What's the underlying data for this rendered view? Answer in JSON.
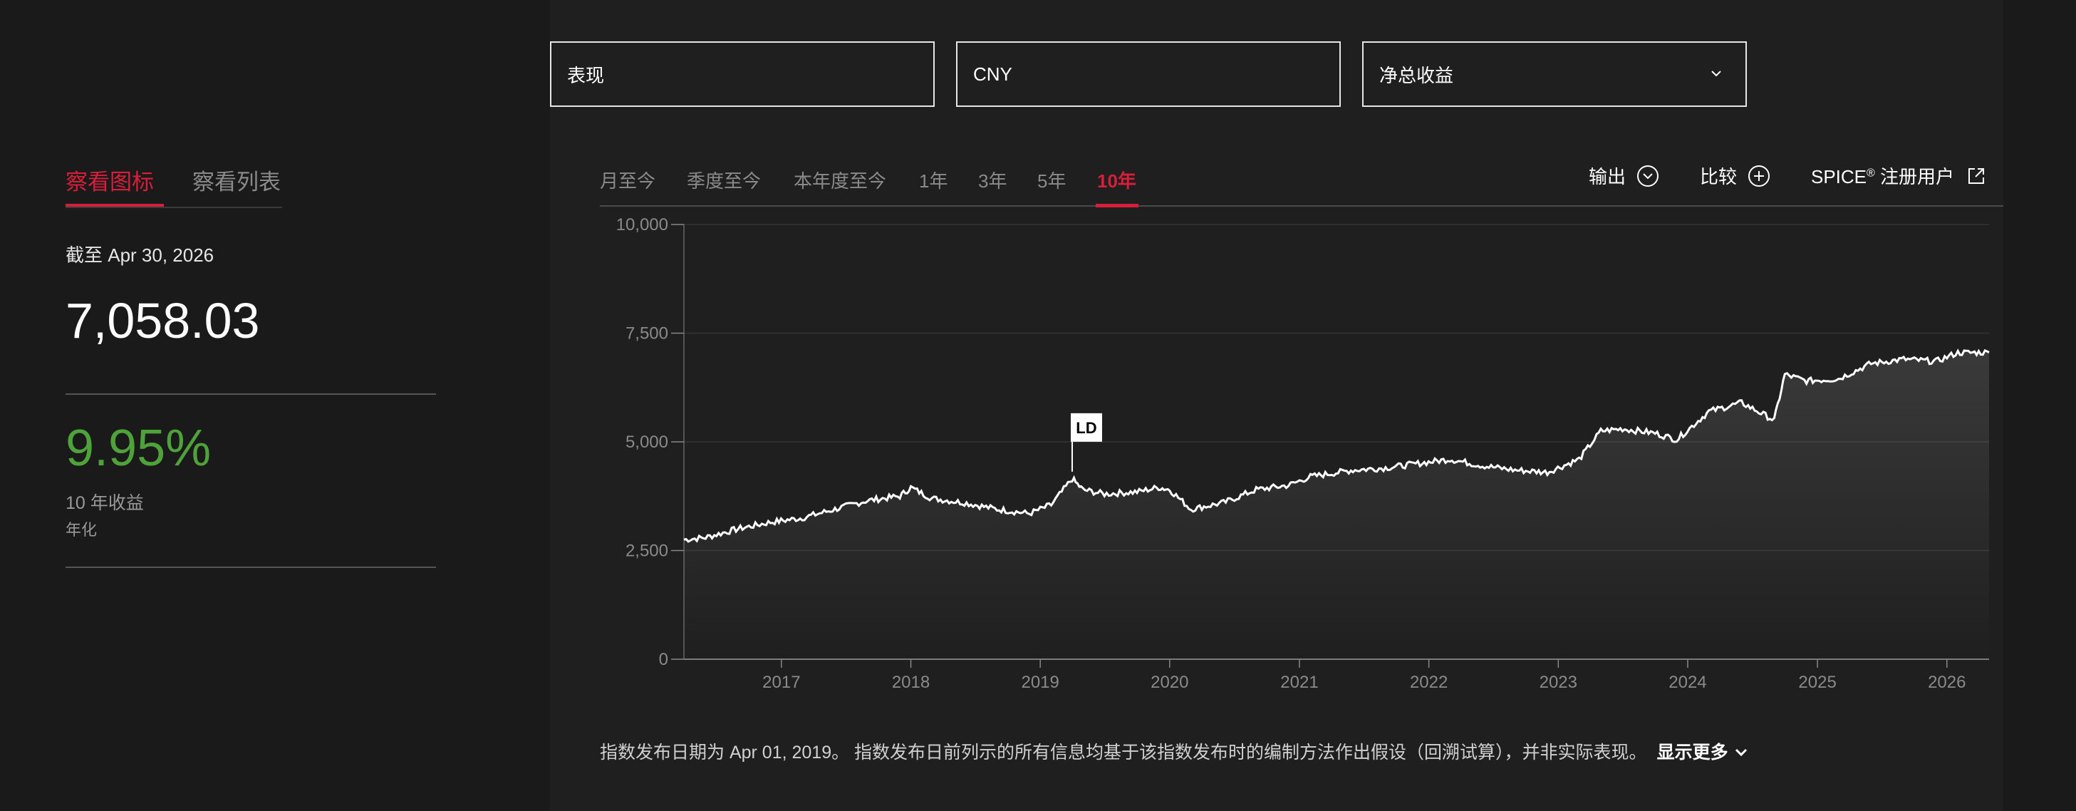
{
  "filters": {
    "metric": "表现",
    "currency": "CNY",
    "return_type": "净总收益"
  },
  "view_tabs": {
    "chart": "察看图标",
    "list": "察看列表"
  },
  "summary": {
    "as_of": "截至 Apr 30, 2026",
    "value": "7,058.03",
    "return_pct": "9.95%",
    "return_label": "10 年收益",
    "annualized": "年化"
  },
  "ranges": [
    "月至今",
    "季度至今",
    "本年度至今",
    "1年",
    "3年",
    "5年",
    "10年"
  ],
  "active_range": "10年",
  "tools": {
    "export": "输出",
    "compare": "比较",
    "spice": "SPICE",
    "spice_reg": "®",
    "spice_suffix": " 注册用户"
  },
  "footnote": {
    "text": "指数发布日期为 Apr 01, 2019。 指数发布日前列示的所有信息均基于该指数发布时的编制方法作出假设（回溯试算），并非实际表现。",
    "more": "显示更多"
  },
  "colors": {
    "accent": "#d71e3a",
    "positive": "#4ea23a",
    "line": "#ffffff"
  },
  "chart_data": {
    "type": "line",
    "title": "",
    "xlabel": "",
    "ylabel": "",
    "ylim": [
      0,
      10000
    ],
    "yticks": [
      0,
      2500,
      5000,
      7500,
      10000
    ],
    "ytick_labels": [
      "0",
      "2,500",
      "5,000",
      "7,500",
      "10,000"
    ],
    "xticks": [
      "2017",
      "2018",
      "2019",
      "2020",
      "2021",
      "2022",
      "2023",
      "2024",
      "2025",
      "2026"
    ],
    "marker": {
      "label": "LD",
      "date": "2019-04-01"
    },
    "series": [
      {
        "x": [
          "2016-04",
          "2016-06",
          "2016-09",
          "2016-12",
          "2017-03",
          "2017-06",
          "2017-09",
          "2017-12",
          "2018-01",
          "2018-03",
          "2018-06",
          "2018-09",
          "2018-12",
          "2019-02",
          "2019-04",
          "2019-05",
          "2019-07",
          "2019-10",
          "2019-12",
          "2020-01",
          "2020-03",
          "2020-06",
          "2020-09",
          "2020-12",
          "2021-02",
          "2021-06",
          "2021-09",
          "2021-12",
          "2022-03",
          "2022-06",
          "2022-09",
          "2022-12",
          "2023-03",
          "2023-05",
          "2023-07",
          "2023-10",
          "2023-12",
          "2024-03",
          "2024-06",
          "2024-09",
          "2024-10",
          "2024-12",
          "2025-03",
          "2025-06",
          "2025-09",
          "2025-12",
          "2026-02",
          "2026-04"
        ],
        "y": [
          2750,
          2800,
          3000,
          3150,
          3250,
          3450,
          3650,
          3750,
          3950,
          3700,
          3600,
          3450,
          3350,
          3550,
          4150,
          3900,
          3800,
          3850,
          3950,
          3900,
          3450,
          3600,
          3900,
          4000,
          4200,
          4350,
          4400,
          4500,
          4600,
          4450,
          4350,
          4300,
          4600,
          5250,
          5300,
          5200,
          5050,
          5700,
          5900,
          5500,
          6550,
          6400,
          6450,
          6800,
          6900,
          6850,
          7050,
          7058
        ]
      }
    ]
  }
}
